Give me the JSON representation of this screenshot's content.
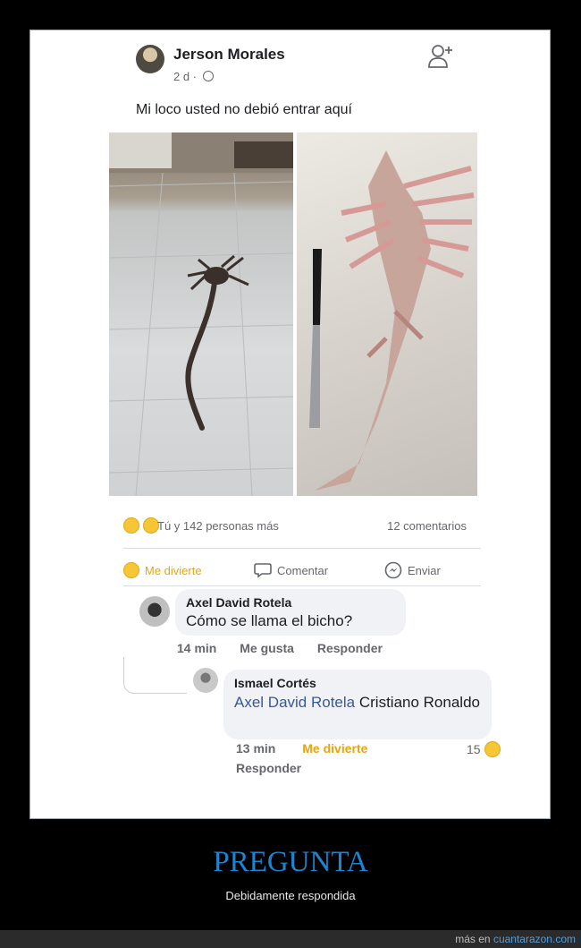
{
  "post": {
    "author": "Jerson Morales",
    "time": "2 d ·",
    "text": "Mi loco usted no debió entrar aquí"
  },
  "reactions": {
    "summary": "Tú y 142 personas más",
    "comments": "12 comentarios"
  },
  "actions": {
    "haha": "Me divierte",
    "comment": "Comentar",
    "send": "Enviar"
  },
  "comments": [
    {
      "name": "Axel David Rotela",
      "text": "Cómo se llama el bicho?",
      "time": "14 min",
      "like": "Me gusta",
      "reply": "Responder"
    },
    {
      "name": "Ismael Cortés",
      "mention": "Axel David Rotela",
      "text": " Cristiano Ronaldo",
      "time": "13 min",
      "reaction": "Me divierte",
      "reaction_count": "15",
      "reply": "Responder"
    }
  ],
  "caption": {
    "title": "PREGUNTA",
    "subtitle": "Debidamente respondida"
  },
  "footer": {
    "prefix": "más en ",
    "link": "cuantarazon.com"
  },
  "colors": {
    "caption_title": "#1e84d0",
    "haha": "#e7a50d",
    "mention": "#385898"
  }
}
